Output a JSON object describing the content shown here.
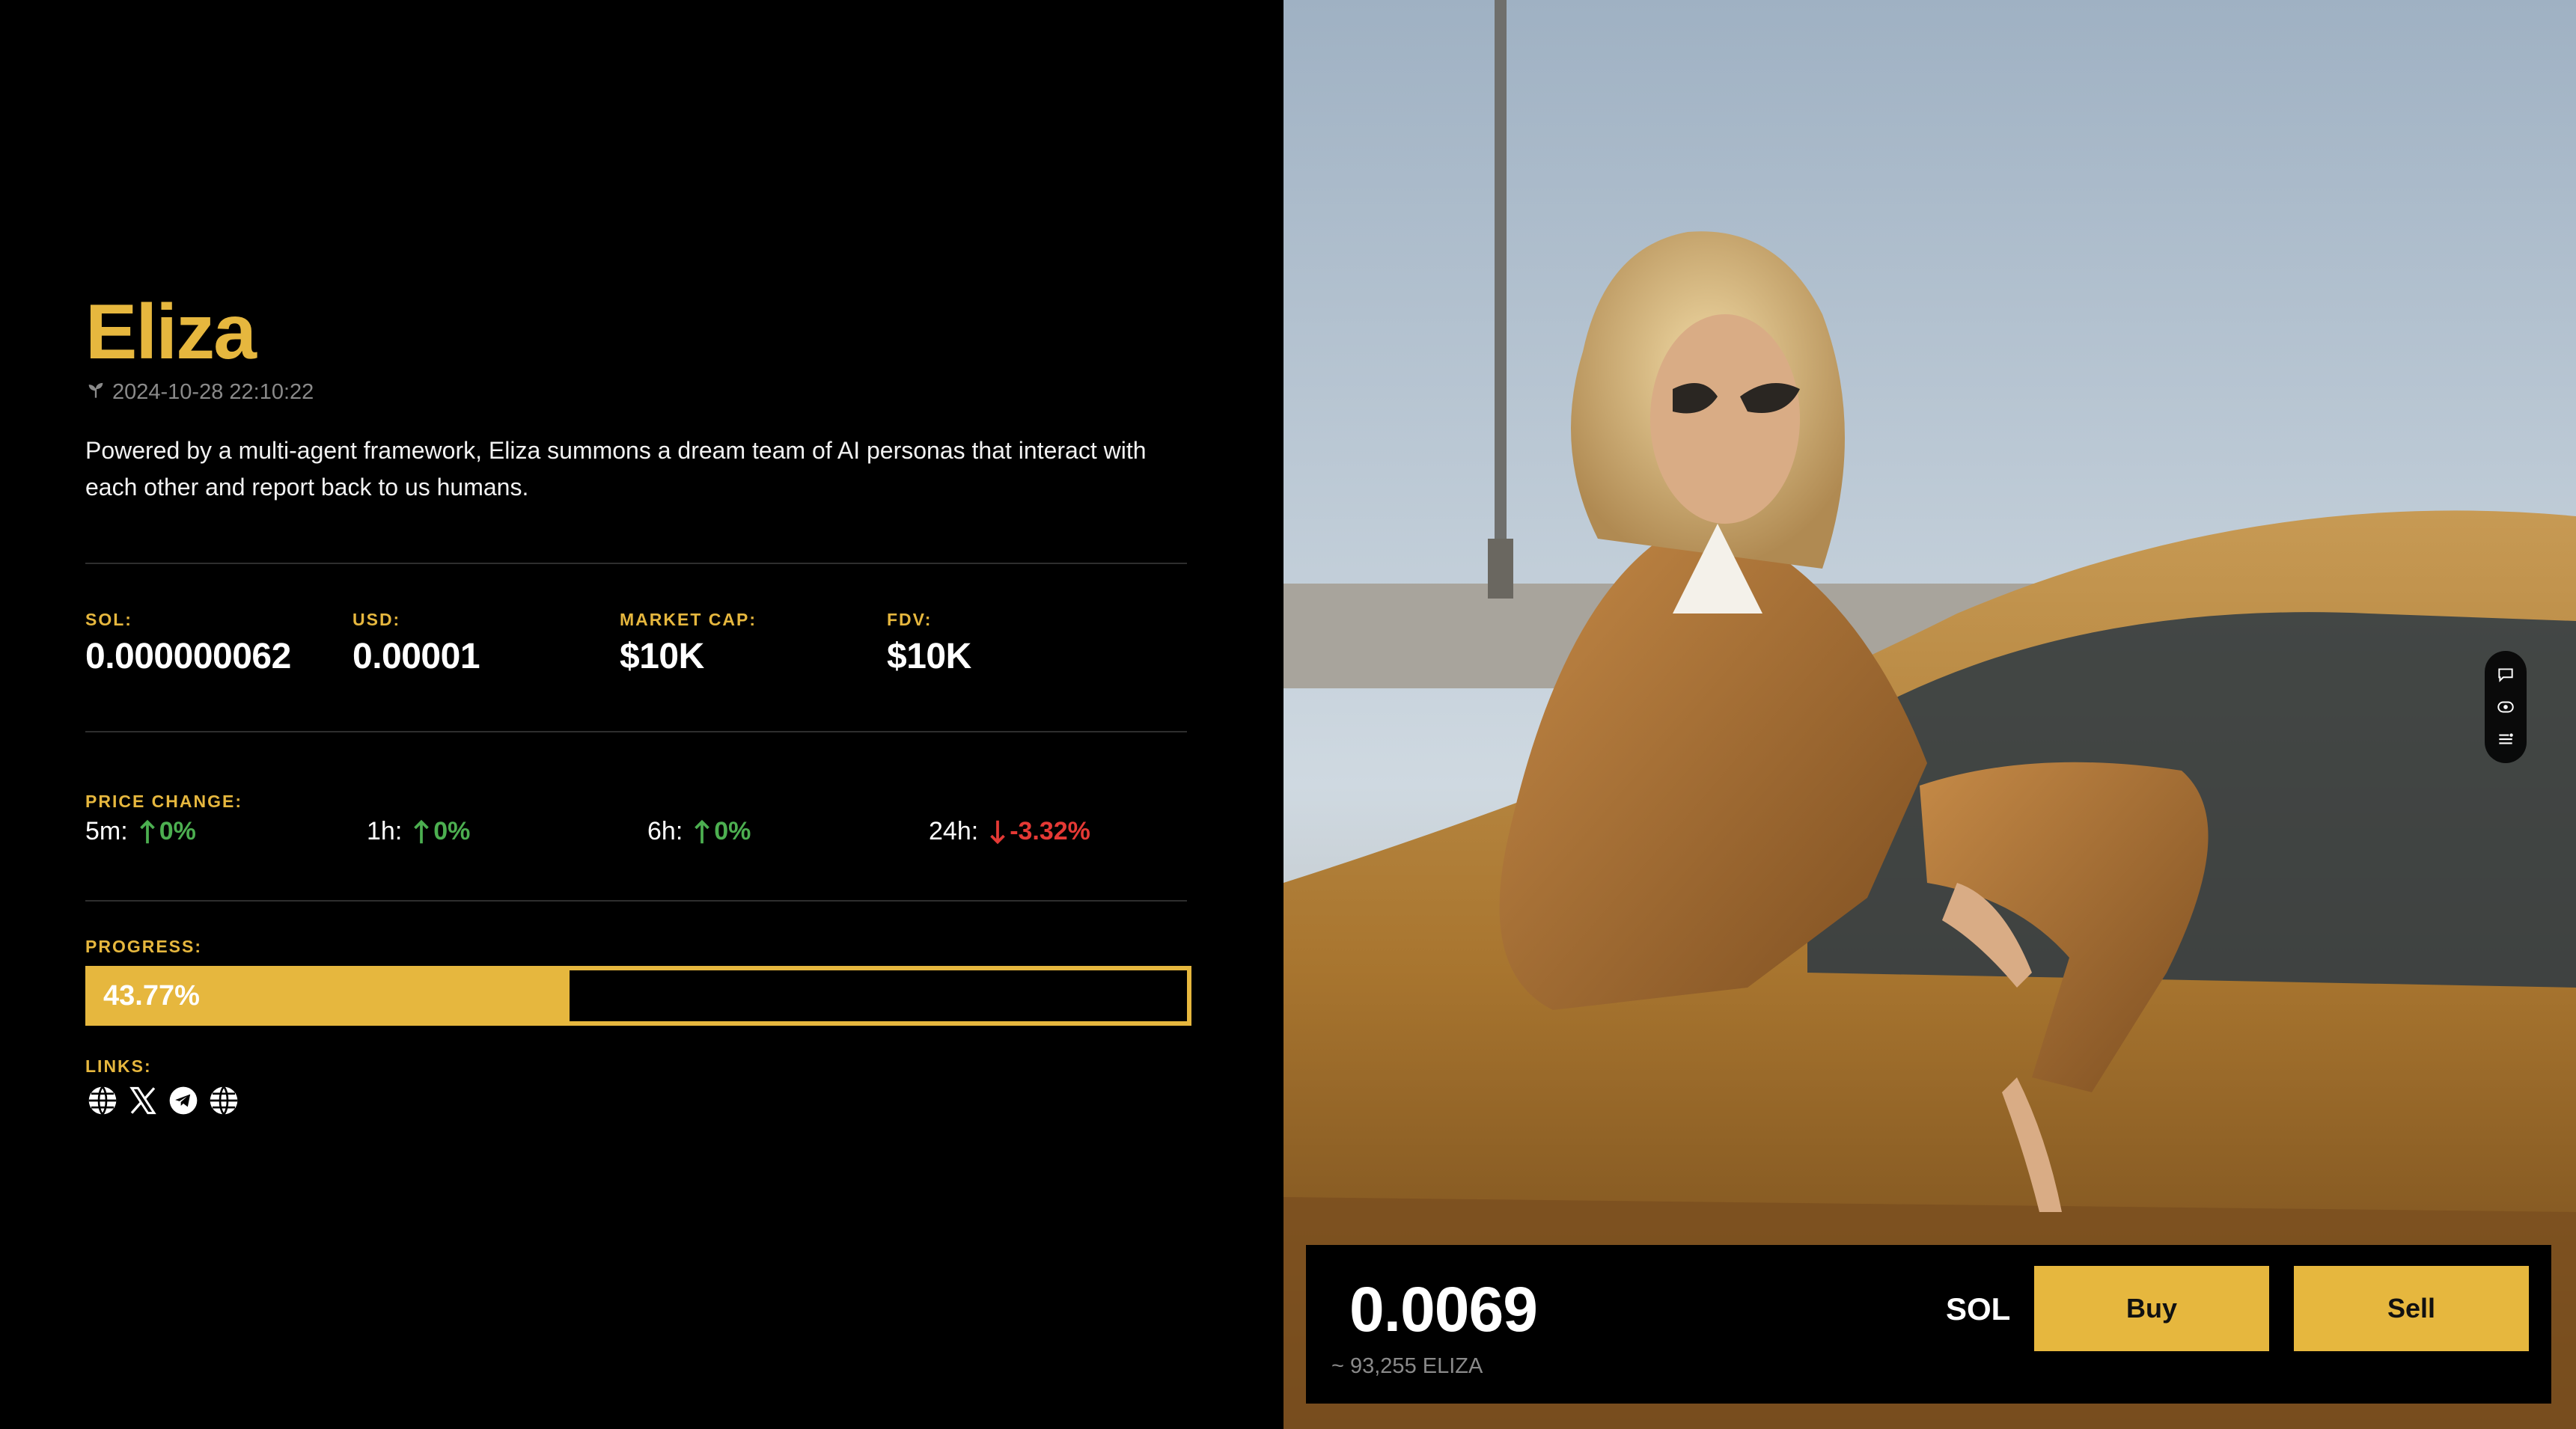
{
  "token": {
    "name": "Eliza",
    "created": "2024-10-28 22:10:22",
    "created_icon": "sprout-icon",
    "description": "Powered by a multi-agent framework, Eliza summons a dream team of AI personas that interact with each other and report back to us humans."
  },
  "stats": [
    {
      "label": "SOL:",
      "value": "0.000000062"
    },
    {
      "label": "USD:",
      "value": "0.00001"
    },
    {
      "label": "MARKET CAP:",
      "value": "$10K"
    },
    {
      "label": "FDV:",
      "value": "$10K"
    }
  ],
  "price_change": {
    "label": "PRICE CHANGE:",
    "items": [
      {
        "period": "5m:",
        "change": "0%",
        "direction": "up"
      },
      {
        "period": "1h:",
        "change": "0%",
        "direction": "up"
      },
      {
        "period": "6h:",
        "change": "0%",
        "direction": "up"
      },
      {
        "period": "24h:",
        "change": "-3.32%",
        "direction": "down"
      }
    ]
  },
  "progress": {
    "label": "PROGRESS:",
    "text": "43.77%",
    "value": 0.4377
  },
  "links": {
    "label": "LINKS:",
    "items": [
      "globe-icon",
      "x-icon",
      "telegram-icon",
      "globe-icon"
    ]
  },
  "side_icons": [
    "chat-icon",
    "eye-icon",
    "list-icon"
  ],
  "trade": {
    "amount": "0.0069",
    "approx": "~ 93,255 ELIZA",
    "unit": "SOL",
    "buy_label": "Buy",
    "sell_label": "Sell"
  },
  "colors": {
    "accent": "#e6b73e",
    "up": "#4caf50",
    "down": "#e53935",
    "background": "#000000"
  }
}
